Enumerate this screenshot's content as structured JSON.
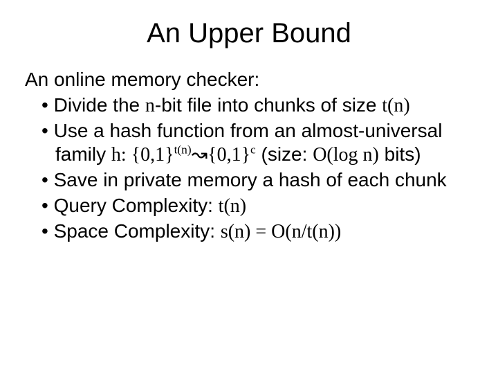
{
  "title": "An Upper Bound",
  "intro": "An online memory checker:",
  "b1_a": "Divide the ",
  "b1_b": "n",
  "b1_c": "-bit file into chunks of size ",
  "b1_d": "t(n)",
  "b2_a": "Use a hash function from an almost-universal family ",
  "b2_b": "h: {0,1}",
  "b2_sup1": "t(n)",
  "b2_arrow": "↝",
  "b2_c": "{0,1}",
  "b2_sup2": "c",
  "b2_d": " (size: ",
  "b2_e": "O(log n)",
  "b2_f": " bits)",
  "b3": "Save in private memory a hash of each chunk",
  "b4_a": "Query Complexity: ",
  "b4_b": "t(n)",
  "b5_a": "Space Complexity: ",
  "b5_b": "s(n) = O(n/t(n))"
}
